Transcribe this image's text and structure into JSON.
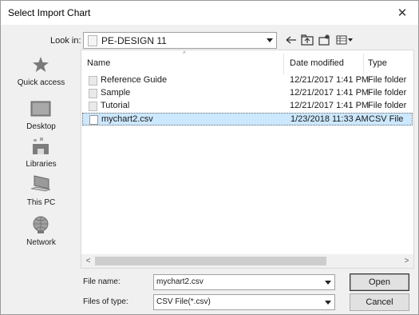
{
  "window": {
    "title": "Select Import Chart",
    "close_glyph": "✕"
  },
  "lookin": {
    "label": "Look in:",
    "value": "PE-DESIGN 11"
  },
  "toolbar": [
    {
      "name": "back-icon"
    },
    {
      "name": "up-folder-icon"
    },
    {
      "name": "new-folder-icon"
    },
    {
      "name": "view-menu-icon"
    }
  ],
  "places": [
    {
      "label": "Quick access",
      "icon": "star-icon"
    },
    {
      "label": "Desktop",
      "icon": "desktop-icon"
    },
    {
      "label": "Libraries",
      "icon": "libraries-icon"
    },
    {
      "label": "This PC",
      "icon": "computer-icon"
    },
    {
      "label": "Network",
      "icon": "network-icon"
    }
  ],
  "columns": {
    "name": "Name",
    "date": "Date modified",
    "type": "Type"
  },
  "files": [
    {
      "name": "Reference Guide",
      "date": "12/21/2017 1:41 PM",
      "type": "File folder",
      "kind": "folder"
    },
    {
      "name": "Sample",
      "date": "12/21/2017 1:41 PM",
      "type": "File folder",
      "kind": "folder"
    },
    {
      "name": "Tutorial",
      "date": "12/21/2017 1:41 PM",
      "type": "File folder",
      "kind": "folder"
    },
    {
      "name": "mychart2.csv",
      "date": "1/23/2018 11:33 AM",
      "type": "CSV File",
      "kind": "file",
      "selected": true
    }
  ],
  "scroll": {
    "left_glyph": "<",
    "right_glyph": ">"
  },
  "filename": {
    "label": "File name:",
    "value": "mychart2.csv"
  },
  "filetype": {
    "label": "Files of type:",
    "value": "CSV File(*.csv)"
  },
  "buttons": {
    "open": "Open",
    "cancel": "Cancel"
  },
  "colors": {
    "selection": "#cce8ff",
    "dialog_bg": "#f0f0f0"
  }
}
